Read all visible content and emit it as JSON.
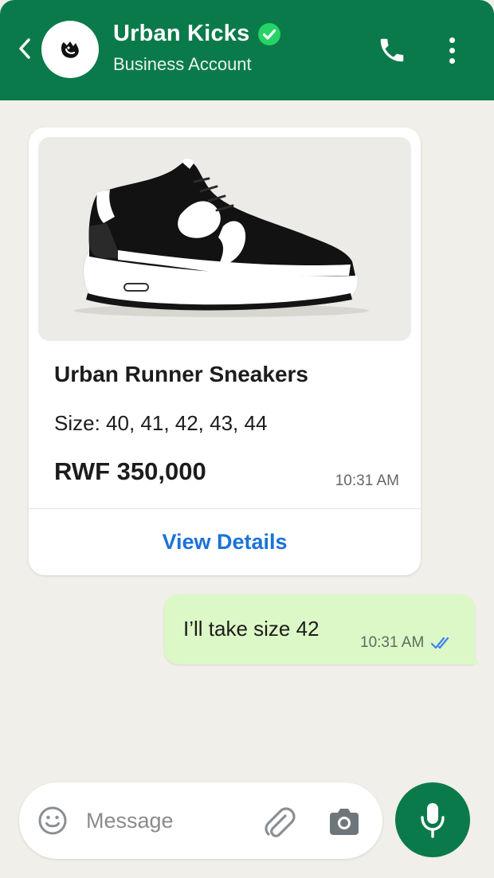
{
  "header": {
    "title": "Urban Kicks",
    "subtitle": "Business Account",
    "verified": true,
    "back_icon": "chevron-left-icon",
    "call_icon": "phone-icon",
    "menu_icon": "more-vertical-icon",
    "avatar_icon": "brand-logo-icon"
  },
  "messages": {
    "product_card": {
      "image_icon": "sneaker-image",
      "name": "Urban Runner Sneakers",
      "sizes": "Size: 40, 41, 42, 43, 44",
      "price": "RWF 350,000",
      "time": "10:31 AM",
      "action_label": "View Details"
    },
    "outgoing": {
      "text": "I’ll take size 42",
      "time": "10:31 AM",
      "status_icon": "double-check-icon",
      "status": "read"
    }
  },
  "composer": {
    "placeholder": "Message",
    "value": "",
    "emoji_icon": "emoji-icon",
    "attach_icon": "paperclip-icon",
    "camera_icon": "camera-icon",
    "mic_icon": "microphone-icon"
  },
  "colors": {
    "brand_green": "#0b7a4a",
    "verified_green": "#25d366",
    "outgoing_bubble": "#dcf8c6",
    "link_blue": "#1a73d9",
    "read_tick_blue": "#3b82f6",
    "chat_background": "#f1efe9"
  }
}
